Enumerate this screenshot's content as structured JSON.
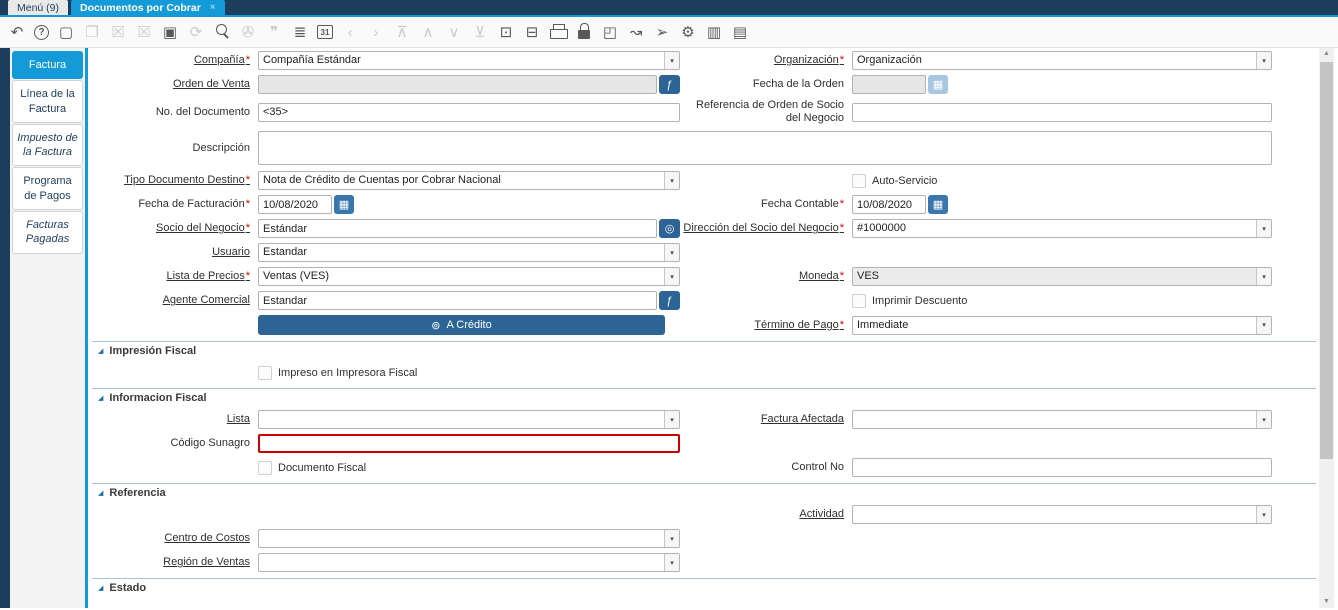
{
  "colors": {
    "accent_blue": "#149bd7",
    "navy": "#1d3d5c",
    "button_blue": "#2c6496",
    "required_red": "#cc0000",
    "error_border": "#cc0000"
  },
  "icons": {
    "close": "×",
    "dropdown": "▾",
    "calendar": "▦",
    "collapse": "◢",
    "scroll_up": "▲",
    "scroll_down": "▼",
    "lookup": "ƒ",
    "record": "◎",
    "credit": "⊚"
  },
  "window": {
    "tabs": [
      {
        "label": "Menú (9)"
      },
      {
        "label": "Documentos por Cobrar"
      }
    ]
  },
  "toolbar": {
    "icons": [
      {
        "name": "undo-icon",
        "glyph": "↶",
        "enabled": true
      },
      {
        "name": "help-icon",
        "glyph": "?",
        "enabled": true,
        "boxed": "circle"
      },
      {
        "name": "new-record-icon",
        "glyph": "▢",
        "enabled": true
      },
      {
        "name": "copy-record-icon",
        "glyph": "❐",
        "enabled": false
      },
      {
        "name": "delete-record-icon",
        "glyph": "☒",
        "enabled": false
      },
      {
        "name": "delete-selection-icon",
        "glyph": "☒",
        "enabled": false
      },
      {
        "name": "save-icon",
        "glyph": "▣",
        "enabled": true
      },
      {
        "name": "refresh-icon",
        "glyph": "⟳",
        "enabled": false
      },
      {
        "name": "find-icon",
        "cls": "mag",
        "enabled": true
      },
      {
        "name": "attachment-icon",
        "glyph": "✇",
        "enabled": false
      },
      {
        "name": "chat-icon",
        "glyph": "❞",
        "enabled": false
      },
      {
        "name": "grid-toggle-icon",
        "glyph": "≣",
        "enabled": true
      },
      {
        "name": "calendar-icon",
        "glyph": "31",
        "enabled": true,
        "boxed": "square"
      },
      {
        "name": "previous-record-icon",
        "glyph": "‹",
        "enabled": false
      },
      {
        "name": "next-record-icon",
        "glyph": "›",
        "enabled": false
      },
      {
        "name": "first-record-icon",
        "glyph": "⊼",
        "enabled": false
      },
      {
        "name": "parent-record-icon",
        "glyph": "∧",
        "enabled": false
      },
      {
        "name": "detail-record-icon",
        "glyph": "∨",
        "enabled": false
      },
      {
        "name": "last-record-icon",
        "glyph": "⊻",
        "enabled": false
      },
      {
        "name": "form-icon",
        "glyph": "⊡",
        "enabled": true
      },
      {
        "name": "archive-icon",
        "glyph": "⊟",
        "enabled": true
      },
      {
        "name": "print-icon",
        "cls": "printer",
        "enabled": true
      },
      {
        "name": "lock-icon",
        "cls": "lock",
        "enabled": true
      },
      {
        "name": "zoom-across-icon",
        "glyph": "◰",
        "enabled": true
      },
      {
        "name": "workflow-icon",
        "glyph": "↝",
        "enabled": true
      },
      {
        "name": "send-icon",
        "glyph": "➢",
        "enabled": true
      },
      {
        "name": "preferences-icon",
        "glyph": "⚙",
        "enabled": true
      },
      {
        "name": "product-info-icon",
        "glyph": "▥",
        "enabled": true
      },
      {
        "name": "report-icon",
        "glyph": "▤",
        "enabled": true
      }
    ]
  },
  "sidebar": {
    "tabs": [
      {
        "label": "Factura",
        "active": true
      },
      {
        "label": "Línea de la Factura"
      },
      {
        "label": "Impuesto de la Factura",
        "italic": true
      },
      {
        "label": "Programa de Pagos"
      },
      {
        "label": "Facturas Pagadas",
        "italic": true
      }
    ]
  },
  "form": {
    "compania": {
      "label": "Compañía",
      "value": "Compañía Estándar"
    },
    "organizacion": {
      "label": "Organización",
      "value": "Organización"
    },
    "orden_venta": {
      "label": "Orden de Venta",
      "value": ""
    },
    "fecha_orden": {
      "label": "Fecha de la Orden",
      "value": ""
    },
    "no_documento": {
      "label": "No. del Documento",
      "value": "<35>"
    },
    "referencia_orden": {
      "label": "Referencia de Orden de Socio del Negocio",
      "value": ""
    },
    "descripcion": {
      "label": "Descripción",
      "value": ""
    },
    "tipo_documento": {
      "label": "Tipo Documento Destino",
      "value": "Nota de Crédito de Cuentas por Cobrar Nacional"
    },
    "auto_servicio": {
      "label": "Auto-Servicio",
      "checked": false
    },
    "fecha_facturacion": {
      "label": "Fecha de Facturación",
      "value": "10/08/2020"
    },
    "fecha_contable": {
      "label": "Fecha Contable",
      "value": "10/08/2020"
    },
    "socio": {
      "label": "Socio del Negocio",
      "value": "Estándar"
    },
    "direccion_socio": {
      "label": "Dirección del Socio del Negocio",
      "value": "#1000000"
    },
    "usuario": {
      "label": "Usuario",
      "value": "Estandar"
    },
    "lista_precios": {
      "label": "Lista de Precios",
      "value": "Ventas (VES)"
    },
    "moneda": {
      "label": "Moneda",
      "value": "VES"
    },
    "agente": {
      "label": "Agente Comercial",
      "value": "Estandar"
    },
    "imprimir_descuento": {
      "label": "Imprimir Descuento",
      "checked": false
    },
    "a_credito": {
      "label": "A Crédito"
    },
    "termino_pago": {
      "label": "Término de Pago",
      "value": "Immediate"
    },
    "impreso_fiscal": {
      "label": "Impreso en Impresora Fiscal",
      "checked": false
    },
    "lista": {
      "label": "Lista",
      "value": ""
    },
    "factura_afectada": {
      "label": "Factura Afectada",
      "value": ""
    },
    "codigo_sunagro": {
      "label": "Código Sunagro",
      "value": ""
    },
    "documento_fiscal": {
      "label": "Documento Fiscal",
      "checked": false
    },
    "control_no": {
      "label": "Control No",
      "value": ""
    },
    "actividad": {
      "label": "Actividad",
      "value": ""
    },
    "centro_costos": {
      "label": "Centro de Costos",
      "value": ""
    },
    "region_ventas": {
      "label": "Región de Ventas",
      "value": ""
    },
    "sections": {
      "impresion_fiscal": "Impresión Fiscal",
      "informacion_fiscal": "Informacion Fiscal",
      "referencia": "Referencia",
      "estado": "Estado"
    }
  }
}
